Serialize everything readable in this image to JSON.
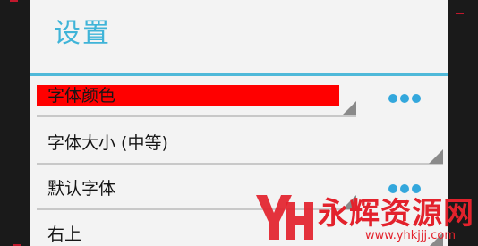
{
  "screen": {
    "title": "设置"
  },
  "settings": {
    "items": [
      {
        "label": "字体颜色",
        "highlighted": true,
        "has_more": true
      },
      {
        "label": "字体大小 (中等)",
        "highlighted": false,
        "has_more": false
      },
      {
        "label": "默认字体",
        "highlighted": false,
        "has_more": true
      },
      {
        "label": "右上",
        "highlighted": false,
        "has_more": false
      }
    ]
  },
  "watermark": {
    "brand": "永辉资源网",
    "url": "www.yhkjjj.com"
  },
  "colors": {
    "accent": "#3fb4d8",
    "highlight": "#ff0000",
    "dots": "#33a7dc",
    "watermark": "#e3222c"
  },
  "icons": {
    "more": "more-dots-icon",
    "spinner": "spinner-corner-icon"
  }
}
